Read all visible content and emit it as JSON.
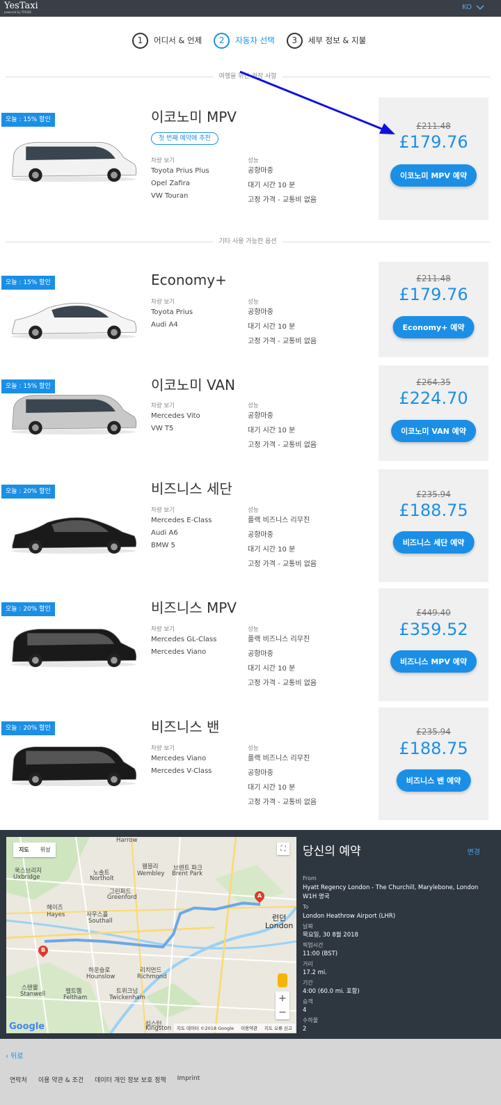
{
  "header": {
    "logo": "YesTaxi",
    "logo_sub": "powered by TRIVEK",
    "lang": "KO"
  },
  "steps": [
    {
      "num": "1",
      "label": "어디서 & 언제"
    },
    {
      "num": "2",
      "label": "자동차 선택"
    },
    {
      "num": "3",
      "label": "세부 정보 & 지불"
    }
  ],
  "sections": {
    "recommended": "여행을 위한 권장 사항",
    "other": "기타 사용 가능한 옵션"
  },
  "col_heads": {
    "examples": "차량 보기",
    "features": "성능"
  },
  "recommended_chip": "첫 번째 예약에 추천",
  "vehicles": [
    {
      "badge": "오늘 : 15% 할인",
      "title": "이코노미 MPV",
      "examples": [
        "Toyota Prius Plus",
        "Opel Zafira",
        "VW Touran"
      ],
      "features": [
        "공항마중",
        "대기 시간 10 분",
        "고정 가격 - 교통비 없음"
      ],
      "old_price": "£211.48",
      "price": "£179.76",
      "button": "이코노미 MPV 예약",
      "car_color": "#f2f2f2"
    },
    {
      "badge": "오늘 : 15% 할인",
      "title": "Economy+",
      "examples": [
        "Toyota Prius",
        "Audi A4"
      ],
      "features": [
        "공항마중",
        "대기 시간 10 분",
        "고정 가격 - 교통비 없음"
      ],
      "old_price": "£211.48",
      "price": "£179.76",
      "button": "Economy+ 예약",
      "car_color": "#f5f5f5"
    },
    {
      "badge": "오늘 : 15% 할인",
      "title": "이코노미 VAN",
      "examples": [
        "Mercedes Vito",
        "VW T5"
      ],
      "features": [
        "공항마중",
        "대기 시간 10 분",
        "고정 가격 - 교통비 없음"
      ],
      "old_price": "£264.35",
      "price": "£224.70",
      "button": "이코노미 VAN 예약",
      "car_color": "#c8c8c8"
    },
    {
      "badge": "오늘 : 20% 할인",
      "title": "비즈니스 세단",
      "examples": [
        "Mercedes E-Class",
        "Audi A6",
        "BMW 5"
      ],
      "features": [
        "플랙 비즈니스 리무진",
        "공항마중",
        "대기 시간 10 분",
        "고정 가격 - 교통비 없음"
      ],
      "old_price": "£235.94",
      "price": "£188.75",
      "button": "비즈니스 세단 예약",
      "car_color": "#1a1a1a"
    },
    {
      "badge": "오늘 : 20% 할인",
      "title": "비즈니스 MPV",
      "examples": [
        "Mercedes GL-Class",
        "Mercedes Viano"
      ],
      "features": [
        "플랙 비즈니스 리무진",
        "공항마중",
        "대기 시간 10 분",
        "고정 가격 - 교통비 없음"
      ],
      "old_price": "£449.40",
      "price": "£359.52",
      "button": "비즈니스 MPV 예약",
      "car_color": "#1a1a1a"
    },
    {
      "badge": "오늘 : 20% 할인",
      "title": "비즈니스 밴",
      "examples": [
        "Mercedes Viano",
        "Mercedes V-Class"
      ],
      "features": [
        "플랙 비즈니스 리무진",
        "공항마중",
        "대기 시간 10 분",
        "고정 가격 - 교통비 없음"
      ],
      "old_price": "£235.94",
      "price": "£188.75",
      "button": "비즈니스 밴 예약",
      "car_color": "#1a1a1a"
    }
  ],
  "map": {
    "tabs": [
      "지도",
      "위성"
    ],
    "labels": [
      "Harrow",
      "웸블리",
      "Wembley",
      "노솔트",
      "Northolt",
      "그린퍼드",
      "Greenford",
      "헤이즈",
      "Hayes",
      "사우스홀",
      "Southall",
      "하운슬로",
      "Hounslow",
      "리치먼드",
      "Richmond",
      "트위크넘",
      "Twickenham",
      "스탠웰",
      "Stanwell",
      "펠트햄",
      "Feltham",
      "욱스브리지",
      "Uxbridge",
      "브렌트 파크",
      "Brent Park",
      "런던",
      "London",
      "킹스턴",
      "Kingston"
    ],
    "pin_a": "A",
    "pin_b": "B",
    "logo": "Google",
    "footer": [
      "지도 데이터 ©2018 Google",
      "이용약관",
      "지도 오류 신고"
    ]
  },
  "booking": {
    "title": "당신의 예약",
    "change": "변경",
    "from_label": "From",
    "from_value": "Hyatt Regency London - The Churchill, Marylebone, London W1H 영국",
    "to_label": "To",
    "to_value": "London Heathrow Airport (LHR)",
    "date_label": "날짜",
    "date_value": "목요일, 30 8월 2018",
    "pickup_label": "픽업시간",
    "pickup_value": "11:00 (BST)",
    "distance_label": "거리",
    "distance_value": "17.2 mi.",
    "duration_label": "기간",
    "duration_value": "4:00 (60.0 mi. 포함)",
    "passengers_label": "승객",
    "passengers_value": "4",
    "luggage_label": "수하물",
    "luggage_value": "2"
  },
  "footer": {
    "back": "‹ 뒤로",
    "links": [
      "연락처",
      "이용 약관 & 조건",
      "데이터 개인 정보 보호 정책",
      "Imprint"
    ]
  },
  "colors": {
    "accent": "#1b8fe6",
    "header_bg": "#3a3f47",
    "summary_bg": "#2e3640",
    "arrow": "#1010e0"
  }
}
